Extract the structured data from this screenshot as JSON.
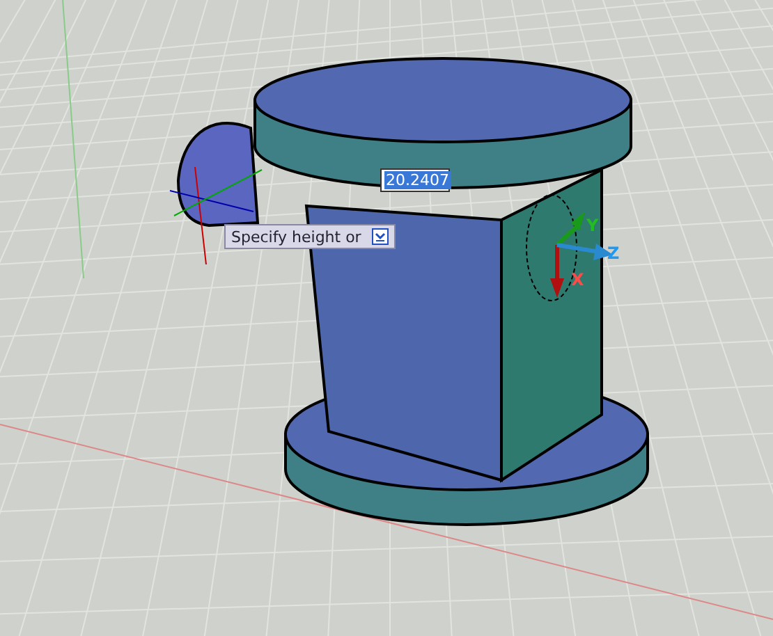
{
  "viewport": {
    "dynamic_input": {
      "value": "20.2407",
      "selected": true
    },
    "tooltip": {
      "prompt": "Specify height or"
    },
    "gizmo": {
      "labels": [
        {
          "text": "Y",
          "color": "#22bb22"
        },
        {
          "text": "Z",
          "color": "#2299ee"
        },
        {
          "text": "X",
          "color": "#ff4a4a"
        }
      ]
    }
  }
}
